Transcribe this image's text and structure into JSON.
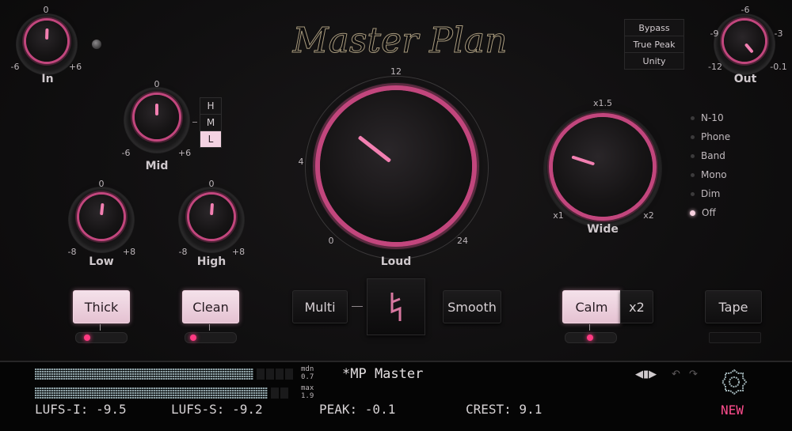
{
  "app": {
    "title": "Master Plan"
  },
  "toggles_top": [
    {
      "label": "Bypass"
    },
    {
      "label": "True Peak"
    },
    {
      "label": "Unity"
    }
  ],
  "knobs": {
    "in": {
      "label": "In",
      "min": "-6",
      "center": "0",
      "max": "+6"
    },
    "out": {
      "label": "Out",
      "min": "-12",
      "t1": "-9",
      "center": "-6",
      "t3": "-3",
      "max": "-0.1"
    },
    "mid": {
      "label": "Mid",
      "min": "-6",
      "center": "0",
      "max": "+6"
    },
    "low": {
      "label": "Low",
      "min": "-8",
      "center": "0",
      "max": "+8"
    },
    "high": {
      "label": "High",
      "min": "-8",
      "center": "0",
      "max": "+8"
    },
    "loud": {
      "label": "Loud",
      "t0": "0",
      "t4": "4",
      "t12": "12",
      "t24": "24"
    },
    "wide": {
      "label": "Wide",
      "min": "x1",
      "center": "x1.5",
      "max": "x2"
    }
  },
  "mid_band": {
    "options": [
      "H",
      "M",
      "L"
    ],
    "selected": "L"
  },
  "monitor": {
    "options": [
      "N-10",
      "Phone",
      "Band",
      "Mono",
      "Dim",
      "Off"
    ],
    "selected": "Off"
  },
  "buttons": {
    "thick": "Thick",
    "clean": "Clean",
    "multi": "Multi",
    "smooth": "Smooth",
    "calm": "Calm",
    "x2": "x2",
    "tape": "Tape"
  },
  "bottom": {
    "meter1_label_a": "mdn",
    "meter1_label_b": "0.7",
    "meter2_label_a": "max",
    "meter2_label_b": "1.9",
    "preset_name": "*MP Master",
    "lufs_i": "LUFS-I: -9.5",
    "lufs_s": "LUFS-S: -9.2",
    "peak": "PEAK: -0.1",
    "crest": "CREST: 9.1",
    "new": "NEW"
  },
  "colors": {
    "accent": "#c2467d",
    "pointer": "#f27fb1",
    "led": "#ff3a82"
  }
}
